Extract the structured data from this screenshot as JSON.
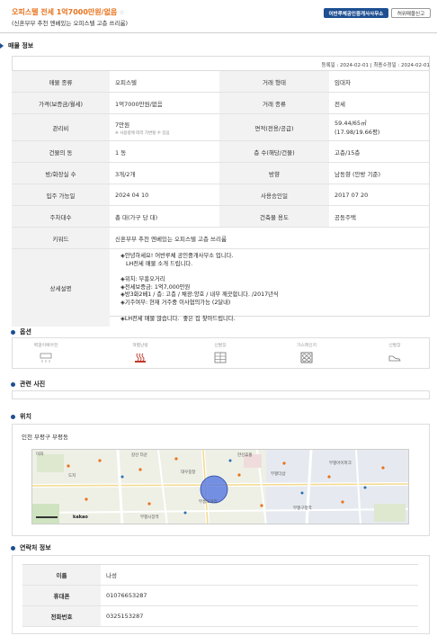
{
  "header": {
    "title": "오피스텔 전세 1억7000만원/없음",
    "star": "☆",
    "subtitle": "(신혼부부 추천 엔베있는 오피스텔 고층 쓰리룸)",
    "office_button": "어반루체공인중개사사무소",
    "report_button": "허위매물신고"
  },
  "property_section": {
    "heading": "매물 정보",
    "reg_dates": "등록일 : 2024-02-01  |  최종수정일 : 2024-02-01",
    "rows": [
      {
        "l1": "매물 종류",
        "v1": "오피스텔",
        "l2": "거래 형태",
        "v2": "임대차"
      },
      {
        "l1": "가격(보증금/월세)",
        "v1": "1억7000만원/없음",
        "l2": "거래 종류",
        "v2": "전세"
      },
      {
        "l1": "관리비",
        "v1": "7만원",
        "v1_note": "※ 사용량에 따라 가변될 수 있음",
        "l2": "면적(전용/공급)",
        "v2": "59.44/65㎡",
        "v2b": "(17.98/19.66평)"
      },
      {
        "l1": "건물의 동",
        "v1": "1 동",
        "l2": "층 수(해당/건물)",
        "v2": "고층/15층"
      },
      {
        "l1": "방/화장실 수",
        "v1": "3개/2개",
        "l2": "방향",
        "v2": "남동향 (안방 기준)"
      },
      {
        "l1": "입주 가능일",
        "v1": "2024 04 10",
        "l2": "사용승인일",
        "v2": "2017 07 20"
      },
      {
        "l1": "주차대수",
        "v1": "총  대(가구 당   대)",
        "l2": "건축물 용도",
        "v2": "공동주택"
      }
    ],
    "keyword_label": "키워드",
    "keyword": "신혼부부 추천 엔베있는 오피스텔 고층 쓰리룸",
    "desc_label": "상세설명",
    "desc_lines": [
      "◈안녕하세요! 어반루체 공인중개사무소 입니다.",
      "   LH전세 매물 소개 드립니다.",
      "",
      "◈위치: 부흥오거리",
      "◈전세보증금: 1억7,000만원",
      "◈방3화2베1 / 층: 고층 / 채광:양호 / 내부 깨끗합니다. /2017년식",
      "◈기주여부: 현재 거주중 이사협의가능 (2달내)",
      "",
      "◈LH전세 매물 많습니다.  좋은 집 찾아드립니다."
    ]
  },
  "options_section": {
    "heading": "옵션",
    "items": [
      {
        "label": "벽걸이에어컨",
        "icon": "aircon-icon"
      },
      {
        "label": "개별난방",
        "icon": "heating-icon"
      },
      {
        "label": "신발장",
        "icon": "shoe-cabinet-icon"
      },
      {
        "label": "가스레인지",
        "icon": "gas-range-icon"
      },
      {
        "label": "신발장",
        "icon": "shoes-icon"
      }
    ]
  },
  "photos_section": {
    "heading": "관련 사진"
  },
  "location_section": {
    "heading": "위치",
    "address": "인천 부평구 부평동",
    "map_logo": "kakao",
    "map_labels": [
      "이화",
      "도지",
      "갈산 타운",
      "대우중창",
      "한신휴폴",
      "부평더샵",
      "부흥오거리",
      "부평구청역",
      "부평아이파크",
      "부평시장역"
    ]
  },
  "contact_section": {
    "heading": "연락처 정보",
    "rows": [
      {
        "label": "이름",
        "value": "나성"
      },
      {
        "label": "휴대폰",
        "value": "01076653287"
      },
      {
        "label": "전화번호",
        "value": "0325153287"
      }
    ]
  },
  "colors": {
    "accent": "#e8731d",
    "brand": "#1d4f91",
    "circle": "#4a6fe0"
  }
}
